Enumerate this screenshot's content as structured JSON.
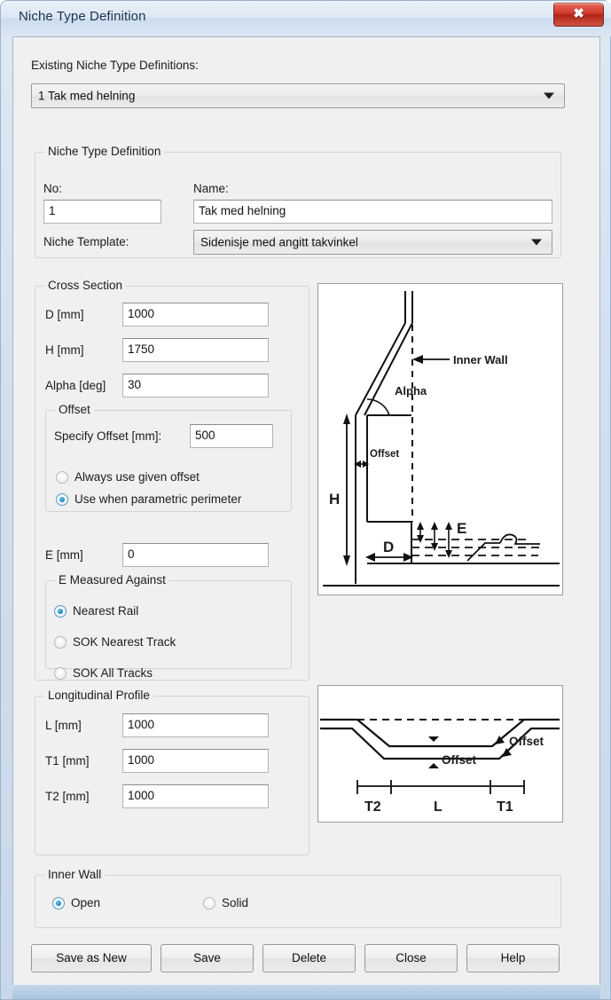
{
  "window": {
    "title": "Niche Type Definition",
    "close_label": "✖"
  },
  "existing": {
    "label": "Existing Niche Type Definitions:",
    "selected": "1 Tak med helning"
  },
  "definition": {
    "group_title": "Niche Type Definition",
    "no_label": "No:",
    "no_value": "1",
    "name_label": "Name:",
    "name_value": "Tak med helning",
    "template_label": "Niche Template:",
    "template_value": "Sidenisje med angitt takvinkel"
  },
  "cross_section": {
    "group_title": "Cross Section",
    "fields": [
      {
        "label": "D [mm]",
        "value": "1000"
      },
      {
        "label": "H [mm]",
        "value": "1750"
      },
      {
        "label": "Alpha [deg]",
        "value": "30"
      }
    ],
    "offset": {
      "group_title": "Offset",
      "specify_label": "Specify Offset [mm]:",
      "specify_value": "500",
      "options": [
        {
          "label": "Always use given offset",
          "selected": false
        },
        {
          "label": "Use when parametric perimeter",
          "selected": true
        }
      ]
    },
    "e_label": "E [mm]",
    "e_value": "0",
    "e_measured": {
      "group_title": "E Measured Against",
      "options": [
        {
          "label": "Nearest Rail",
          "selected": true
        },
        {
          "label": "SOK Nearest Track",
          "selected": false
        },
        {
          "label": "SOK All Tracks",
          "selected": false
        }
      ]
    }
  },
  "longitudinal": {
    "group_title": "Longitudinal Profile",
    "fields": [
      {
        "label": "L [mm]",
        "value": "1000"
      },
      {
        "label": "T1 [mm]",
        "value": "1000"
      },
      {
        "label": "T2 [mm]",
        "value": "1000"
      }
    ]
  },
  "inner_wall": {
    "group_title": "Inner Wall",
    "options": [
      {
        "label": "Open",
        "selected": true
      },
      {
        "label": "Solid",
        "selected": false
      }
    ]
  },
  "buttons": [
    {
      "label": "Save as New"
    },
    {
      "label": "Save"
    },
    {
      "label": "Delete"
    },
    {
      "label": "Close"
    },
    {
      "label": "Help"
    }
  ],
  "cross_section_diagram": {
    "labels": {
      "inner_wall": "Inner Wall",
      "alpha": "Alpha",
      "offset": "Offset",
      "h": "H",
      "d": "D",
      "e": "E"
    }
  },
  "longitudinal_diagram": {
    "labels": {
      "offset_left": "Offset",
      "offset_right": "Offset",
      "t2": "T2",
      "l": "L",
      "t1": "T1"
    }
  }
}
